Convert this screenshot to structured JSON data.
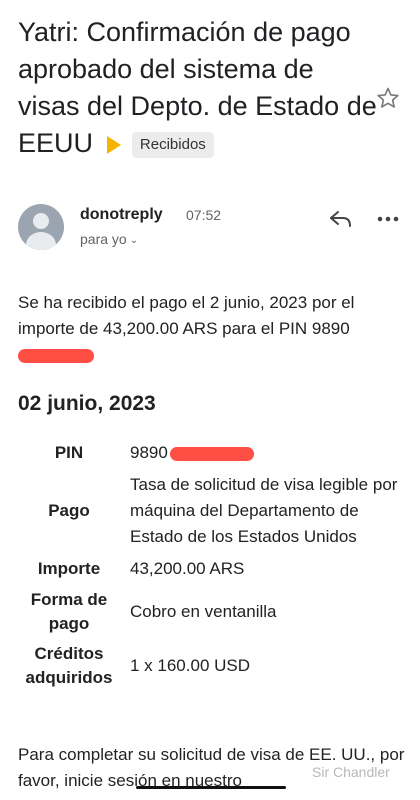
{
  "email": {
    "subject": "Yatri: Confirmación de pago aprobado del sistema de visas del Depto. de Estado de EEUU",
    "label": "Recibidos",
    "label_color": "#f4b400"
  },
  "sender": {
    "name": "donotreply",
    "time": "07:52",
    "recipient": "para yo"
  },
  "body": {
    "intro": "Se ha recibido el pago el 2 junio, 2023 por el importe de 43,200.00 ARS para el PIN 9890",
    "date_heading": "02 junio, 2023",
    "details": [
      {
        "key": "PIN",
        "value": "9890"
      },
      {
        "key": "Pago",
        "value": "Tasa de solicitud de visa legible por máquina del Departamento de Estado de los Estados Unidos"
      },
      {
        "key": "Importe",
        "value": "43,200.00 ARS"
      },
      {
        "key": "Forma de pago",
        "value": "Cobro en ventanilla"
      },
      {
        "key": "Créditos adquiridos",
        "value": "1 x 160.00 USD"
      }
    ],
    "footer": "Para completar su solicitud de visa de EE. UU., por favor, inicie sesión en nuestro"
  },
  "watermark": "Sir Chandler",
  "colors": {
    "redaction": "#ff3b30"
  }
}
